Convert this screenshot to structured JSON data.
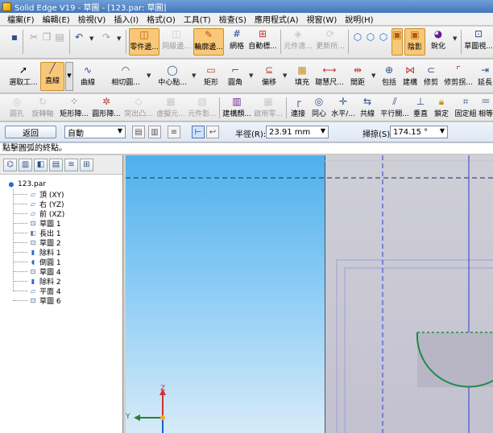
{
  "window": {
    "title": "Solid Edge V19 - 草圖 - [123.par: 草圖]"
  },
  "menu": [
    "檔案(F)",
    "編輯(E)",
    "檢視(V)",
    "插入(I)",
    "格式(O)",
    "工具(T)",
    "檢查(S)",
    "應用程式(A)",
    "視窗(W)",
    "說明(H)"
  ],
  "toolbar1": {
    "part_features": "零件邊...",
    "same_sketch": "同級邊...",
    "contour_edges": "輪廓邊...",
    "grid": "網格",
    "auto_sketch": "自動標...",
    "element_clear": "元件清...",
    "update": "更新所...",
    "shading": "陰影",
    "sharpen": "銳化",
    "sketch_view": "草圖視..."
  },
  "toolbar2": {
    "select_tool": "選取工...",
    "line": "直線",
    "curve": "曲線",
    "tangent_arc": "相切圓...",
    "center_point": "中心點...",
    "rectangle": "矩形",
    "fillet": "圓角",
    "offset": "偏移",
    "fill": "填充",
    "smart_dimension": "聰慧尺...",
    "spacing": "間距",
    "include": "包括",
    "relate": "建構",
    "trim": "修剪",
    "trim_corner": "修剪拐...",
    "extend": "延長"
  },
  "toolbar3": {
    "hole": "圓孔",
    "revolve": "旋轉軸",
    "rect_pattern": "矩形陣...",
    "circ_pattern": "圓形陣...",
    "emboss": "突出凸...",
    "virtual_body": "虛擬元...",
    "element_shadow": "元件影...",
    "build_color": "建構顏...",
    "enable_zero": "啟用零...",
    "connect": "連接",
    "concentric": "同心",
    "horizontal": "水平/...",
    "collinear": "共線",
    "parallel": "平行關...",
    "perpendicular": "垂直",
    "lock": "鎖定",
    "fix_set": "固定組",
    "equal": "相等"
  },
  "ribbon": {
    "back_label": "返回",
    "mode_value": "自動",
    "radius_label": "半徑(R):",
    "radius_value": "23.91 mm",
    "sweep_label": "掃掠(S):",
    "sweep_value": "174.15 °"
  },
  "prompt": "點擊圓弧的終點。",
  "tree": {
    "root": "123.par",
    "items": [
      {
        "label": "頂 (XY)",
        "icon": "plane-icon"
      },
      {
        "label": "右 (YZ)",
        "icon": "plane-icon"
      },
      {
        "label": "前 (XZ)",
        "icon": "plane-icon"
      },
      {
        "label": "草圖 1",
        "icon": "sketch-icon"
      },
      {
        "label": "長出 1",
        "icon": "protrusion-icon"
      },
      {
        "label": "草圖 2",
        "icon": "sketch-icon"
      },
      {
        "label": "除料 1",
        "icon": "cutout-icon"
      },
      {
        "label": "倒圓 1",
        "icon": "round-icon"
      },
      {
        "label": "草圖 4",
        "icon": "sketch-icon"
      },
      {
        "label": "除料 2",
        "icon": "cutout-icon"
      },
      {
        "label": "平面 4",
        "icon": "plane-icon"
      },
      {
        "label": "草圖 6",
        "icon": "sketch-icon"
      }
    ]
  },
  "axis": {
    "y_label": "Y",
    "z_label": "Z"
  },
  "colors": {
    "active_tool": "#f8c878",
    "sketch_line": "#1f8a4a",
    "reference_line": "#2d3bd6",
    "sky_top": "#4fb0ec",
    "sheet": "#c6c4d1"
  }
}
